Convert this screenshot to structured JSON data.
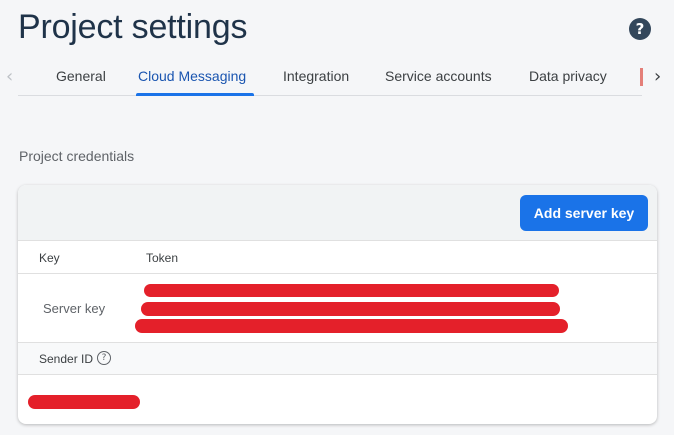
{
  "header": {
    "title": "Project settings",
    "help_icon": "?"
  },
  "tabs": [
    {
      "label": "General",
      "active": false
    },
    {
      "label": "Cloud Messaging",
      "active": true
    },
    {
      "label": "Integration",
      "active": false
    },
    {
      "label": "Service accounts",
      "active": false
    },
    {
      "label": "Data privacy",
      "active": false
    }
  ],
  "nav": {
    "prev_icon": "‹",
    "next_icon": "›"
  },
  "credentials": {
    "section_label": "Project credentials",
    "add_button_label": "Add server key",
    "columns": [
      "Key",
      "Token"
    ],
    "server_key_label": "Server key",
    "server_key_token": "[redacted]",
    "sender_id_label": "Sender ID",
    "sender_id_value": "[redacted]"
  },
  "colors": {
    "accent": "#1a73e8",
    "redaction": "#e4202a",
    "title": "#1f3349"
  }
}
